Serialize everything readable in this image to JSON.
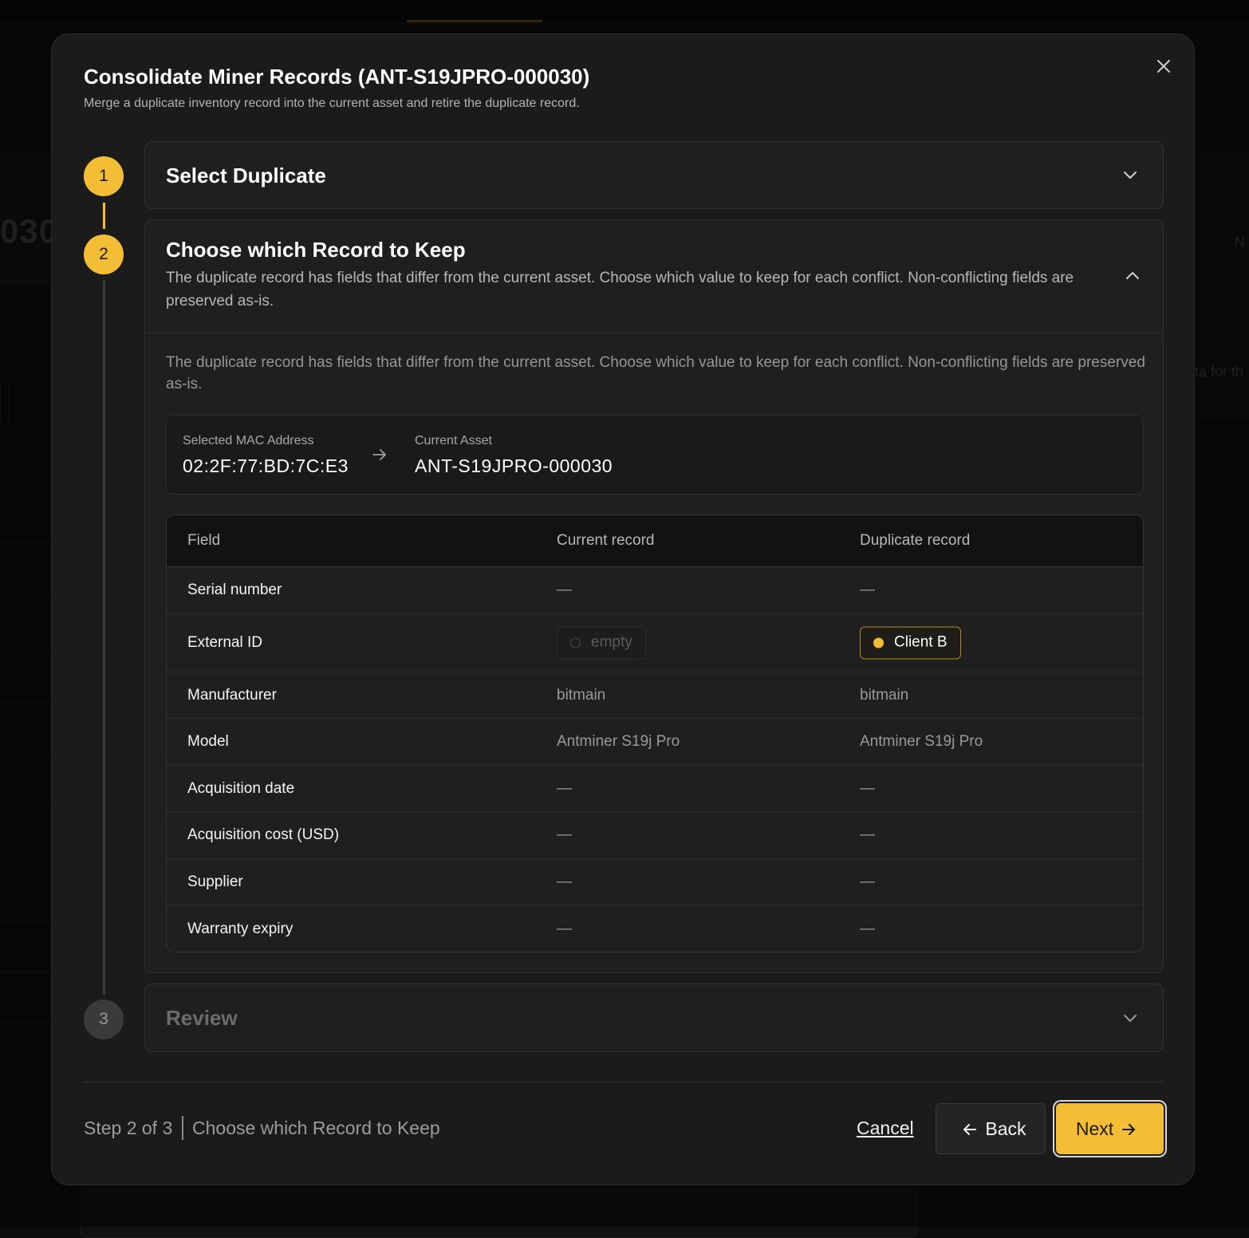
{
  "background": {
    "partial_text_left": "030",
    "partial_text_right_1": "N",
    "partial_text_right_2": "ta for th"
  },
  "modal": {
    "title": "Consolidate Miner Records (ANT-S19JPRO-000030)",
    "subtitle": "Merge a duplicate inventory record into the current asset and retire the duplicate record.",
    "close_icon": "close-icon"
  },
  "stepper": {
    "steps": [
      {
        "number": "1",
        "title": "Select Duplicate",
        "state": "completed"
      },
      {
        "number": "2",
        "title": "Choose which Record to Keep",
        "state": "active",
        "description": "The duplicate record has fields that differ from the current asset. Choose which value to keep for each conflict. Non-conflicting fields are preserved as-is."
      },
      {
        "number": "3",
        "title": "Review",
        "state": "inactive"
      }
    ]
  },
  "step2_body": {
    "description": "The duplicate record has fields that differ from the current asset. Choose which value to keep for each conflict. Non-conflicting fields are preserved as-is.",
    "mac": {
      "selected_label": "Selected MAC Address",
      "selected_value": "02:2F:77:BD:7C:E3",
      "current_label": "Current Asset",
      "current_value": "ANT-S19JPRO-000030"
    },
    "table": {
      "headers": [
        "Field",
        "Current record",
        "Duplicate record"
      ],
      "rows": [
        {
          "field": "Serial number",
          "current": "—",
          "duplicate": "—"
        },
        {
          "field": "External ID",
          "current": "empty",
          "duplicate": "Client B",
          "conflict": true,
          "selected": "duplicate"
        },
        {
          "field": "Manufacturer",
          "current": "bitmain",
          "duplicate": "bitmain"
        },
        {
          "field": "Model",
          "current": "Antminer S19j Pro",
          "duplicate": "Antminer S19j Pro"
        },
        {
          "field": "Acquisition date",
          "current": "—",
          "duplicate": "—"
        },
        {
          "field": "Acquisition cost (USD)",
          "current": "—",
          "duplicate": "—"
        },
        {
          "field": "Supplier",
          "current": "—",
          "duplicate": "—"
        },
        {
          "field": "Warranty expiry",
          "current": "—",
          "duplicate": "—"
        }
      ]
    }
  },
  "footer": {
    "step_indicator": "Step 2 of 3",
    "step_title": "Choose which Record to Keep",
    "cancel_label": "Cancel",
    "back_label": "Back",
    "next_label": "Next"
  },
  "colors": {
    "accent": "#f3bd35",
    "modal_bg": "#1b1b1b",
    "section_bg": "#1f1f1f",
    "border": "#323232"
  }
}
